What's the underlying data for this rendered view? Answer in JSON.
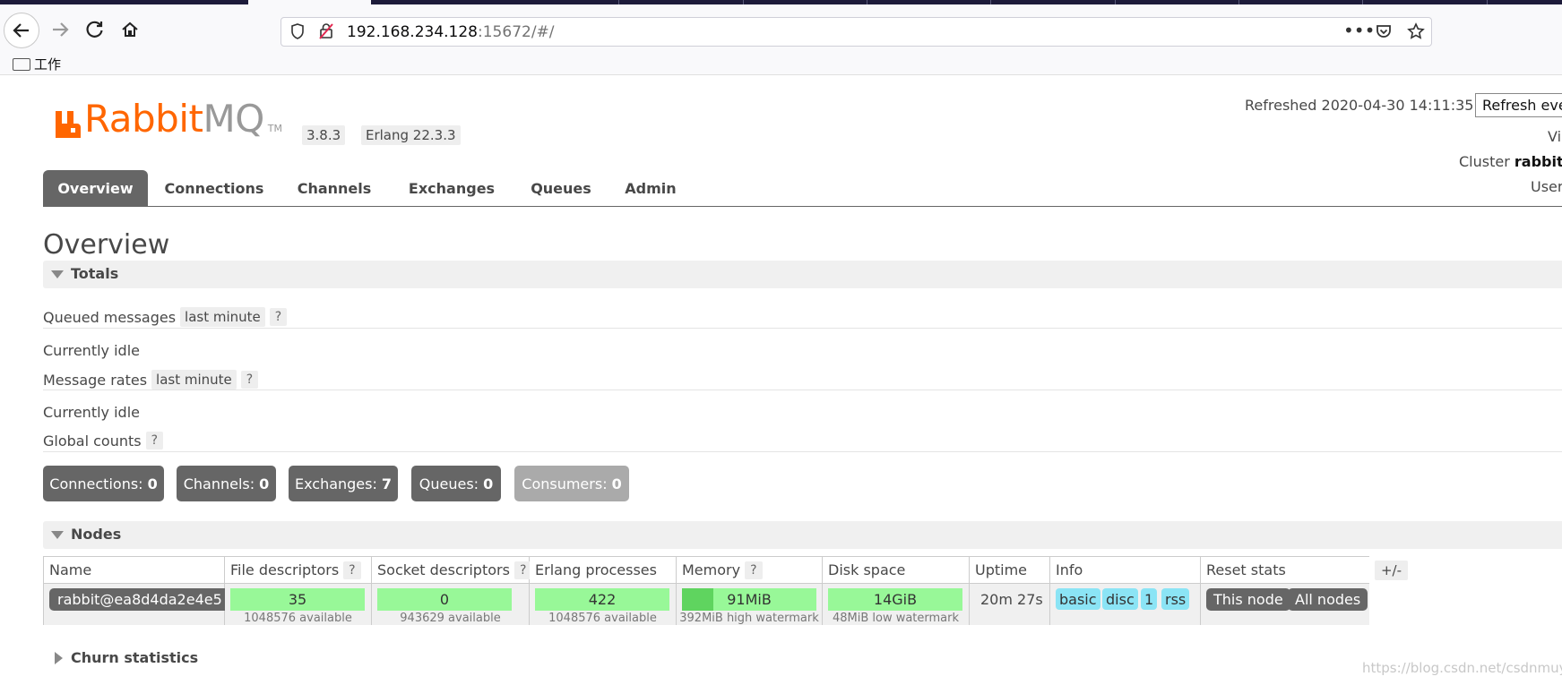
{
  "browser": {
    "url_host": "192.168.234.128",
    "url_rest": ":15672/#/",
    "bookmark": "工作"
  },
  "header": {
    "logo_rabbit": "Rabbit",
    "logo_mq": "MQ",
    "logo_tm": "TM",
    "version": "3.8.3",
    "erlang": "Erlang 22.3.3",
    "refreshed": "Refreshed 2020-04-30 14:11:35",
    "refresh_select": "Refresh every",
    "vi": "Vi",
    "cluster_label": "Cluster",
    "cluster_value": "rabbit@",
    "user": "User"
  },
  "tabs": [
    "Overview",
    "Connections",
    "Channels",
    "Exchanges",
    "Queues",
    "Admin"
  ],
  "page_title": "Overview",
  "totals": {
    "title": "Totals",
    "queued_label": "Queued messages",
    "queued_range": "last minute",
    "help": "?",
    "idle1": "Currently idle",
    "rates_label": "Message rates",
    "rates_range": "last minute",
    "idle2": "Currently idle",
    "global_label": "Global counts"
  },
  "counts": [
    {
      "label": "Connections:",
      "value": "0"
    },
    {
      "label": "Channels:",
      "value": "0"
    },
    {
      "label": "Exchanges:",
      "value": "7"
    },
    {
      "label": "Queues:",
      "value": "0"
    },
    {
      "label": "Consumers:",
      "value": "0"
    }
  ],
  "nodes": {
    "title": "Nodes",
    "headers": [
      "Name",
      "File descriptors",
      "Socket descriptors",
      "Erlang processes",
      "Memory",
      "Disk space",
      "Uptime",
      "Info",
      "Reset stats"
    ],
    "toggle": "+/-",
    "row": {
      "name": "rabbit@ea8d4da2e4e5",
      "fd": "35",
      "fd_sub": "1048576 available",
      "sd": "0",
      "sd_sub": "943629 available",
      "ep": "422",
      "ep_sub": "1048576 available",
      "mem": "91MiB",
      "mem_sub": "392MiB high watermark",
      "mem_fraction": 0.23,
      "disk": "14GiB",
      "disk_sub": "48MiB low watermark",
      "uptime": "20m 27s",
      "info": [
        "basic",
        "disc",
        "1",
        "rss"
      ],
      "reset_this": "This node",
      "reset_all": "All nodes"
    }
  },
  "churn_title": "Churn statistics",
  "watermark": "https://blog.csdn.net/csdnmuyi"
}
